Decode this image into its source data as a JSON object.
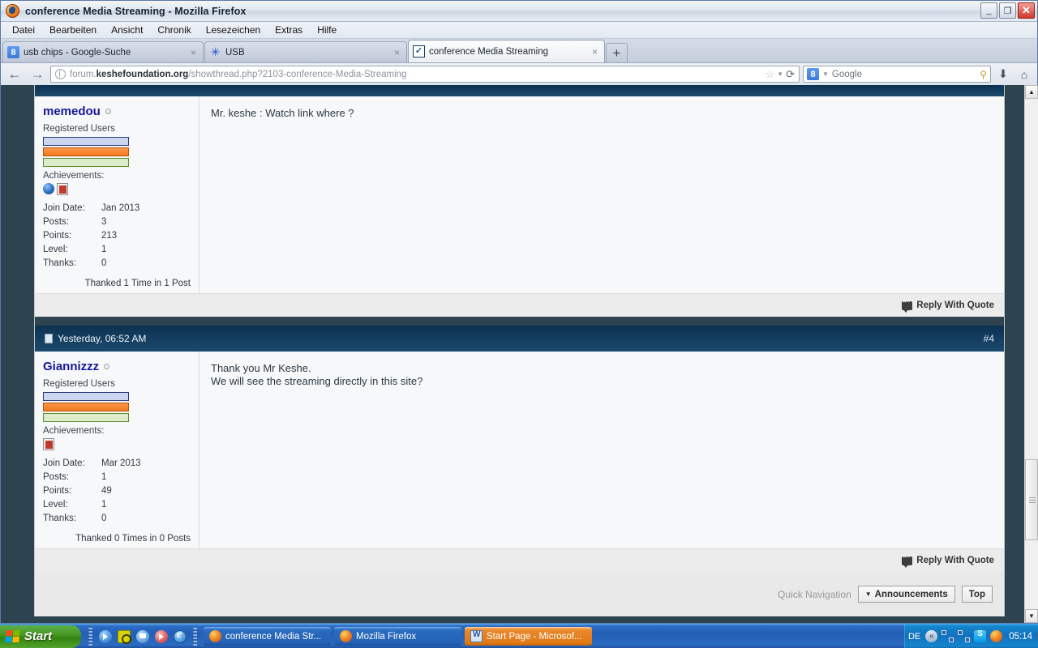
{
  "window": {
    "title": "conference Media Streaming - Mozilla Firefox",
    "minimize": "_",
    "restore": "❐",
    "close": "✕"
  },
  "menubar": [
    {
      "label": "Datei"
    },
    {
      "label": "Bearbeiten"
    },
    {
      "label": "Ansicht"
    },
    {
      "label": "Chronik"
    },
    {
      "label": "Lesezeichen"
    },
    {
      "label": "Extras"
    },
    {
      "label": "Hilfe"
    }
  ],
  "tabs": [
    {
      "label": "usb chips - Google-Suche",
      "favicon": "google-icon",
      "favicon_glyph": "8",
      "close": "×",
      "active": false
    },
    {
      "label": "USB",
      "favicon": "starburst-icon",
      "favicon_glyph": "✳",
      "close": "×",
      "active": false
    },
    {
      "label": "conference Media Streaming",
      "favicon": "forum-icon",
      "favicon_glyph": "✓",
      "close": "×",
      "active": true
    }
  ],
  "newtab_label": "+",
  "navbar": {
    "back_glyph": "←",
    "forward_glyph": "→",
    "url_prefix": "forum.",
    "url_domain": "keshefoundation.org",
    "url_suffix": "/showthread.php?2103-conference-Media-Streaming",
    "star_glyph": "☆",
    "caret_glyph": "▼",
    "reload_glyph": "⟳",
    "search_engine": "Google",
    "search_glyph": "8",
    "magnifier_glyph": "⚲",
    "download_glyph": "⬇",
    "home_glyph": "⌂"
  },
  "posts": [
    {
      "header": {
        "date": "",
        "number": ""
      },
      "user": {
        "name": "memedou",
        "usergroup": "Registered Users",
        "achievements_label": "Achievements:",
        "achievement_icons": [
          "globe-icon",
          "document-icon"
        ],
        "stats": [
          {
            "key": "Join Date:",
            "value": "Jan 2013"
          },
          {
            "key": "Posts:",
            "value": "3"
          },
          {
            "key": "Points:",
            "value": "213"
          },
          {
            "key": "Level:",
            "value": "1"
          },
          {
            "key": "Thanks:",
            "value": "0"
          }
        ],
        "thanked": "Thanked 1 Time in 1 Post"
      },
      "message": "Mr. keshe : Watch link where ?",
      "reply_label": "Reply With Quote"
    },
    {
      "header": {
        "date": "Yesterday, 06:52 AM",
        "number": "#4"
      },
      "user": {
        "name": "Giannizzz",
        "usergroup": "Registered Users",
        "achievements_label": "Achievements:",
        "achievement_icons": [
          "document-icon"
        ],
        "stats": [
          {
            "key": "Join Date:",
            "value": "Mar 2013"
          },
          {
            "key": "Posts:",
            "value": "1"
          },
          {
            "key": "Points:",
            "value": "49"
          },
          {
            "key": "Level:",
            "value": "1"
          },
          {
            "key": "Thanks:",
            "value": "0"
          }
        ],
        "thanked": "Thanked 0 Times in 0 Posts"
      },
      "message": "Thank you Mr Keshe.\nWe will see the streaming directly in this site?",
      "reply_label": "Reply With Quote"
    }
  ],
  "bottom_nav": {
    "quick_nav_label": "Quick Navigation",
    "select_caret": "▼",
    "select_value": "Announcements",
    "top_label": "Top"
  },
  "scrollbar": {
    "up": "▲",
    "down": "▼"
  },
  "taskbar": {
    "start_label": "Start",
    "quicklaunch": [
      "media-player-icon",
      "nero-icon",
      "messenger-icon",
      "realplayer-icon",
      "internet-explorer-icon"
    ],
    "tasks": [
      {
        "label": "conference Media Str...",
        "icon": "firefox-icon",
        "active": true
      },
      {
        "label": "Mozilla Firefox",
        "icon": "firefox-icon",
        "active": false
      },
      {
        "label": "Start Page - Microsof...",
        "icon": "word-icon",
        "active": false
      }
    ],
    "tray": {
      "language": "DE",
      "chevron": "«",
      "icons": [
        "network-icon",
        "network-icon",
        "skype-icon",
        "firefox-icon"
      ],
      "clock": "05:14"
    }
  },
  "colors": {
    "page_bg": "#2d4450",
    "post_header": "#0e3a5a",
    "username": "#16189c",
    "accent_orange": "#f47a1f",
    "taskbar_blue": "#2a6cc0"
  }
}
